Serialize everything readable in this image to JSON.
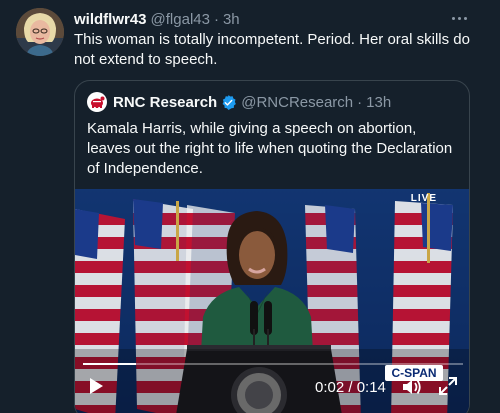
{
  "tweet": {
    "display_name": "wildflwr43",
    "handle": "@flgal43",
    "separator": "·",
    "time": "3h",
    "text": "This woman is totally incompetent.  Period.  Her oral skills do not extend to speech."
  },
  "quoted": {
    "display_name": "RNC Research",
    "handle": "@RNCResearch",
    "separator": "·",
    "time": "13h",
    "text": "Kamala Harris, while giving a speech on abortion, leaves out the right to life when quoting the Declaration of Independence."
  },
  "video": {
    "live_label": "LIVE",
    "time_readout": "0:02 / 0:14",
    "broadcaster": "C-SPAN",
    "progress": 0.14
  },
  "colors": {
    "background": "#15202b",
    "secondary_text": "#8b98a5",
    "border": "#38444d",
    "verified": "#1d9bf0"
  }
}
